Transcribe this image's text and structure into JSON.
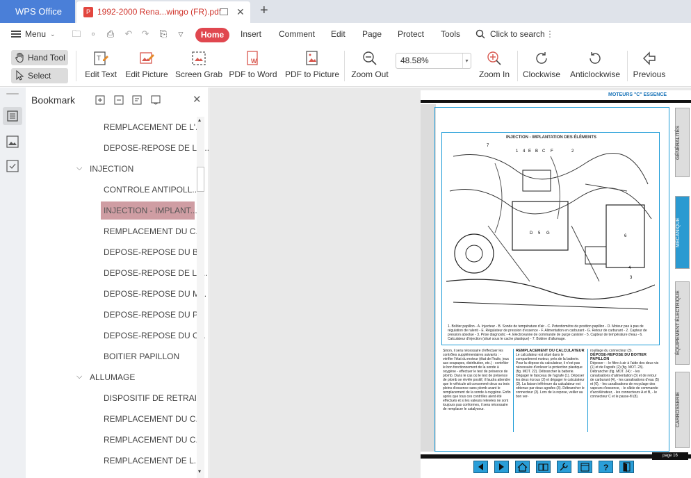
{
  "tabs": {
    "app_label": "WPS Office",
    "doc_label": "1992-2000 Rena...wingo (FR).pdf"
  },
  "menu": {
    "menu_label": "Menu",
    "home": "Home",
    "items": [
      "Insert",
      "Comment",
      "Edit",
      "Page",
      "Protect",
      "Tools"
    ],
    "search_label": "Click to search"
  },
  "toolbar": {
    "hand_tool": "Hand Tool",
    "select_tool": "Select Tool",
    "edit_text": "Edit Text",
    "edit_picture": "Edit Picture",
    "screen_grab": "Screen Grab",
    "pdf_to_word": "PDF to Word",
    "pdf_to_picture": "PDF to Picture",
    "zoom_out": "Zoom Out",
    "zoom_value": "48.58%",
    "zoom_in": "Zoom In",
    "clockwise": "Clockwise",
    "anticlockwise": "Anticlockwise",
    "previous": "Previous"
  },
  "bookmark": {
    "title": "Bookmark",
    "items": [
      "REMPLACEMENT DE L'...",
      "DEPOSE-REPOSE DE LA...",
      "INJECTION",
      "CONTROLE ANTIPOLL...",
      "INJECTION - IMPLANT...",
      "REMPLACEMENT DU C...",
      "DEPOSE-REPOSE DU B...",
      "DEPOSE-REPOSE DE L'I...",
      "DEPOSE-REPOSE DU M...",
      "DEPOSE-REPOSE DU P...",
      "DEPOSE-REPOSE DU C...",
      "BOITIER PAPILLON",
      "ALLUMAGE",
      "DISPOSITIF DE RETRAI...",
      "REMPLACEMENT DU C...",
      "REMPLACEMENT DU C...",
      "REMPLACEMENT DE L..."
    ]
  },
  "pdf": {
    "header": "MOTEURS \"C\" ESSENCE",
    "side_tabs": [
      "GÉNÉRALITÉS",
      "MÉCANIQUE",
      "ÉQUIPEMENT ÉLECTRIQUE",
      "CARROSSERIE"
    ],
    "figure_title": "INJECTION - IMPLANTATION DES ÉLÉMENTS",
    "figure_labels": [
      "7",
      "1",
      "4",
      "E",
      "B",
      "C",
      "F",
      "2",
      "D",
      "5",
      "G",
      "6",
      "4",
      "3"
    ],
    "caption": "1. Boîtier papillon - A. Injecteur - B. Sonde de température d'air - C. Potentiomètre de position papillon - D. Moteur pas à pas de régulation de ralenti - E. Régulateur de pression d'essence - F. Alimentation en carburant - G. Retour de carburant - 2. Capteur de pression absolue - 3. Prise diagnostic - 4. Electrovanne de commande de purge canister - 5. Capteur de température d'eau - 6. Calculateur d'injection (situé sous le cache plastique) - 7. Bobine d'allumage.",
    "col1": "Sinon, il sera nécessaire d'effectuer les contrôles supplémentaires suivants : - vérifier l'état du moteur (état de l'huile, jeux aux soupapes, distribution, etc.) - contrôler le bon fonctionnement de la sonde à oxygène - effectuer le test de présence de plomb. Dans le cas où le test de présence de plomb se révèle positif, il faudra attendre que le véhicule ait consommé deux ou trois pleins d'essence sans plomb avant le remplacement de la sonde à oxygène. Enfin après que tous ces contrôles aient été effectués et si les valeurs relevées ne sont toujours pas conformes, il sera nécessaire de remplacer le catalyseur.",
    "col2_title": "REMPLACEMENT DU CALCULATEUR",
    "col2": "Le calculateur est situé dans le compartiment moteur, près de la batterie. Pour la dépose du calculateur, il n'est pas nécessaire d'enlever la protection plastique (fig. MOT. 22). Débrancher la batterie. Dégager le faisceau de l'agrafe (1). Déposer les deux écrous (2) et dégager le calculateur (3). La liaison inférieure du calculateur est obtenue par deux agrafes (3). Débrancher le connecteur (3). Lors de la repose, veiller au bon ver-",
    "col3_top": "rouillage du connecteur (3).",
    "col3_title": "DÉPOSE-REPOSE DU BOITIER PAPILLON",
    "col3": "Déposer : - le filtre à air à l'aide des deux vis (1) et de l'agrafe (2) (fig. MOT. 23). Débrancher (fig. MOT. 24) : - les canalisations d'alimentation (3) et de retour de carburant (4), - les canalisations d'eau (5) et (6), - les canalisations de recyclage des vapeurs d'essence, - le câble de commande d'accélérateur, - les connecteurs A et B, - le connecteur C et le passe-fil (8).",
    "page_label": "page 16"
  }
}
